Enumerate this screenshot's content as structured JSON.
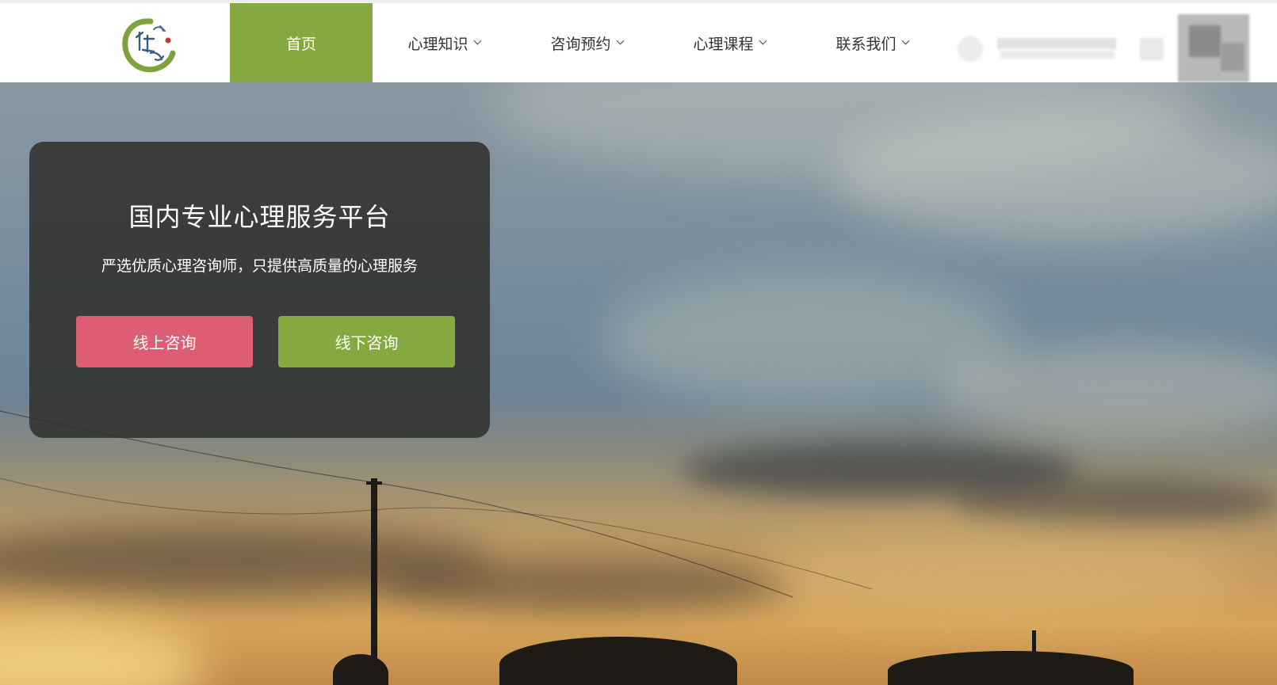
{
  "header": {
    "logo_alt": "Logo",
    "nav": [
      {
        "label": "首页",
        "active": true
      },
      {
        "label": "心理知识",
        "dropdown": true
      },
      {
        "label": "咨询预约",
        "dropdown": true
      },
      {
        "label": "心理课程",
        "dropdown": true
      },
      {
        "label": "联系我们",
        "dropdown": true
      }
    ]
  },
  "hero": {
    "title": "国内专业心理服务平台",
    "subtitle": "严选优质心理咨询师，只提供高质量的心理服务",
    "buttons": {
      "online": "线上咨询",
      "offline": "线下咨询"
    }
  },
  "colors": {
    "brand_green": "#86a840",
    "accent_pink": "#dd5e72"
  },
  "icons": [
    "chevron-down-icon",
    "logo-icon"
  ]
}
